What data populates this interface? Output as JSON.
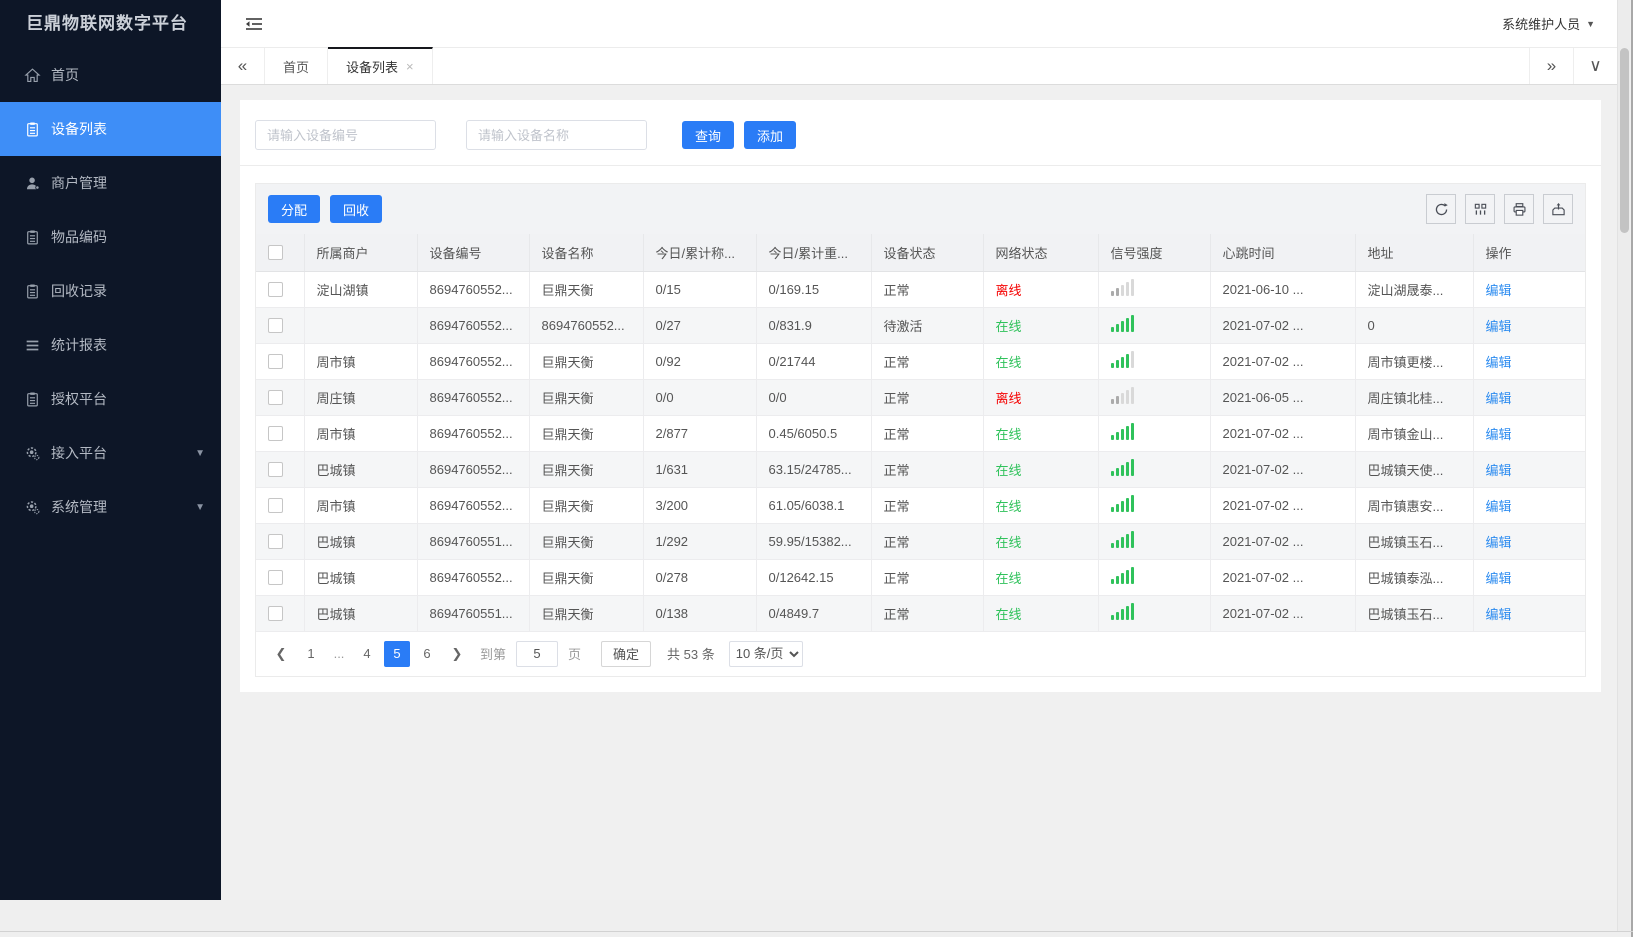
{
  "app": {
    "title": "巨鼎物联网数字平台",
    "user_name": "系统维护人员"
  },
  "sidebar": {
    "items": [
      {
        "label": "首页",
        "icon": "home-icon",
        "active": false
      },
      {
        "label": "设备列表",
        "icon": "clipboard-icon",
        "active": true
      },
      {
        "label": "商户管理",
        "icon": "user-icon",
        "active": false
      },
      {
        "label": "物品编码",
        "icon": "clipboard-icon",
        "active": false
      },
      {
        "label": "回收记录",
        "icon": "clipboard-icon",
        "active": false
      },
      {
        "label": "统计报表",
        "icon": "lines-icon",
        "active": false
      },
      {
        "label": "授权平台",
        "icon": "clipboard-icon",
        "active": false
      },
      {
        "label": "接入平台",
        "icon": "gear-icon",
        "active": false,
        "expandable": true
      },
      {
        "label": "系统管理",
        "icon": "gear-icon",
        "active": false,
        "expandable": true
      }
    ]
  },
  "tabbar": {
    "tabs": [
      {
        "label": "首页",
        "active": false,
        "closable": false
      },
      {
        "label": "设备列表",
        "active": true,
        "closable": true
      }
    ]
  },
  "filters": {
    "device_no_placeholder": "请输入设备编号",
    "device_name_placeholder": "请输入设备名称",
    "query_button": "查询",
    "add_button": "添加"
  },
  "toolbar": {
    "assign_button": "分配",
    "recycle_button": "回收",
    "icons": [
      "refresh-icon",
      "columns-icon",
      "print-icon",
      "export-icon"
    ]
  },
  "table": {
    "columns": [
      "所属商户",
      "设备编号",
      "设备名称",
      "今日/累计称...",
      "今日/累计重...",
      "设备状态",
      "网络状态",
      "信号强度",
      "心跳时间",
      "地址",
      "操作"
    ],
    "edit_label": "编辑",
    "rows": [
      {
        "merchant": "淀山湖镇",
        "device_no": "8694760552...",
        "device_name": "巨鼎天衡",
        "today_count": "0/15",
        "today_weight": "0/169.15",
        "device_status": "正常",
        "network": "离线",
        "online": false,
        "signal_level": 2,
        "heartbeat": "2021-06-10 ...",
        "address": "淀山湖晟泰..."
      },
      {
        "merchant": "",
        "device_no": "8694760552...",
        "device_name": "8694760552...",
        "today_count": "0/27",
        "today_weight": "0/831.9",
        "device_status": "待激活",
        "network": "在线",
        "online": true,
        "signal_level": 5,
        "heartbeat": "2021-07-02 ...",
        "address": "0"
      },
      {
        "merchant": "周市镇",
        "device_no": "8694760552...",
        "device_name": "巨鼎天衡",
        "today_count": "0/92",
        "today_weight": "0/21744",
        "device_status": "正常",
        "network": "在线",
        "online": true,
        "signal_level": 4,
        "heartbeat": "2021-07-02 ...",
        "address": "周市镇更楼..."
      },
      {
        "merchant": "周庄镇",
        "device_no": "8694760552...",
        "device_name": "巨鼎天衡",
        "today_count": "0/0",
        "today_weight": "0/0",
        "device_status": "正常",
        "network": "离线",
        "online": false,
        "signal_level": 2,
        "heartbeat": "2021-06-05 ...",
        "address": "周庄镇北桂..."
      },
      {
        "merchant": "周市镇",
        "device_no": "8694760552...",
        "device_name": "巨鼎天衡",
        "today_count": "2/877",
        "today_weight": "0.45/6050.5",
        "device_status": "正常",
        "network": "在线",
        "online": true,
        "signal_level": 5,
        "heartbeat": "2021-07-02 ...",
        "address": "周市镇金山..."
      },
      {
        "merchant": "巴城镇",
        "device_no": "8694760552...",
        "device_name": "巨鼎天衡",
        "today_count": "1/631",
        "today_weight": "63.15/24785...",
        "device_status": "正常",
        "network": "在线",
        "online": true,
        "signal_level": 5,
        "heartbeat": "2021-07-02 ...",
        "address": "巴城镇天使..."
      },
      {
        "merchant": "周市镇",
        "device_no": "8694760552...",
        "device_name": "巨鼎天衡",
        "today_count": "3/200",
        "today_weight": "61.05/6038.1",
        "device_status": "正常",
        "network": "在线",
        "online": true,
        "signal_level": 5,
        "heartbeat": "2021-07-02 ...",
        "address": "周市镇惠安..."
      },
      {
        "merchant": "巴城镇",
        "device_no": "8694760551...",
        "device_name": "巨鼎天衡",
        "today_count": "1/292",
        "today_weight": "59.95/15382...",
        "device_status": "正常",
        "network": "在线",
        "online": true,
        "signal_level": 5,
        "heartbeat": "2021-07-02 ...",
        "address": "巴城镇玉石..."
      },
      {
        "merchant": "巴城镇",
        "device_no": "8694760552...",
        "device_name": "巨鼎天衡",
        "today_count": "0/278",
        "today_weight": "0/12642.15",
        "device_status": "正常",
        "network": "在线",
        "online": true,
        "signal_level": 5,
        "heartbeat": "2021-07-02 ...",
        "address": "巴城镇泰泓..."
      },
      {
        "merchant": "巴城镇",
        "device_no": "8694760551...",
        "device_name": "巨鼎天衡",
        "today_count": "0/138",
        "today_weight": "0/4849.7",
        "device_status": "正常",
        "network": "在线",
        "online": true,
        "signal_level": 5,
        "heartbeat": "2021-07-02 ...",
        "address": "巴城镇玉石..."
      }
    ]
  },
  "pagination": {
    "prev": "❮",
    "pages": [
      "1",
      "...",
      "4",
      "5",
      "6"
    ],
    "active_page": "5",
    "next": "❯",
    "jump_prefix": "到第",
    "jump_value": "5",
    "jump_suffix": "页",
    "confirm_button": "确定",
    "total_text": "共 53 条",
    "page_size_option": "10 条/页"
  },
  "colors": {
    "accent_blue": "#2a7cf6",
    "sidebar_active_blue": "#3e8ef7",
    "online_green": "#2fc25b",
    "offline_red": "#f50000",
    "link_blue": "#2d8cf0",
    "signal_inactive": "#d9d9d9",
    "signal_offline": "#ababab"
  }
}
